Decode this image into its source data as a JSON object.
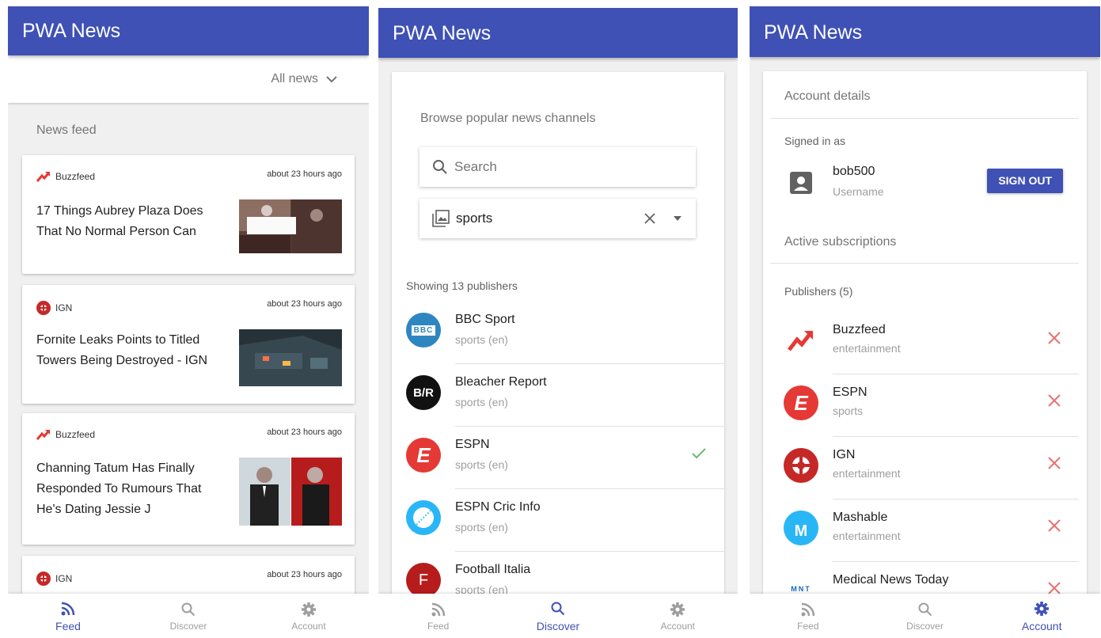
{
  "app_title": "PWA News",
  "colors": {
    "primary": "#3f51b5",
    "remove": "#e57373",
    "check": "#66bb6a"
  },
  "nav": {
    "feed": "Feed",
    "discover": "Discover",
    "account": "Account"
  },
  "feed": {
    "filter": "All news",
    "section": "News feed",
    "items": [
      {
        "source": "Buzzfeed",
        "time": "about 23 hours ago",
        "title": "17 Things Aubrey Plaza Does That No Normal Person Can"
      },
      {
        "source": "IGN",
        "time": "about 23 hours ago",
        "title": "Fornite Leaks Points to Titled Towers Being Destroyed - IGN"
      },
      {
        "source": "Buzzfeed",
        "time": "about 23 hours ago",
        "title": "Channing Tatum Has Finally Responded To Rumours That He's Dating Jessie J"
      },
      {
        "source": "IGN",
        "time": "about 23 hours ago",
        "title": ""
      }
    ]
  },
  "discover": {
    "heading": "Browse popular news channels",
    "search_placeholder": "Search",
    "category": "sports",
    "showing": "Showing 13 publishers",
    "publishers": [
      {
        "name": "BBC Sport",
        "cat": "sports (en)",
        "logo": "BBC"
      },
      {
        "name": "Bleacher Report",
        "cat": "sports (en)",
        "logo": "B/R"
      },
      {
        "name": "ESPN",
        "cat": "sports (en)",
        "logo": "E"
      },
      {
        "name": "ESPN Cric Info",
        "cat": "sports (en)",
        "logo": ""
      },
      {
        "name": "Football Italia",
        "cat": "sports (en)",
        "logo": "F"
      }
    ]
  },
  "account": {
    "heading": "Account details",
    "signed_in_as": "Signed in as",
    "username": "bob500",
    "username_label": "Username",
    "sign_out": "SIGN OUT",
    "active_subs": "Active subscriptions",
    "publishers_count": "Publishers (5)",
    "subscriptions": [
      {
        "name": "Buzzfeed",
        "cat": "entertainment"
      },
      {
        "name": "ESPN",
        "cat": "sports",
        "logo": "E"
      },
      {
        "name": "IGN",
        "cat": "entertainment"
      },
      {
        "name": "Mashable",
        "cat": "entertainment",
        "logo": "M"
      },
      {
        "name": "Medical News Today",
        "cat": "",
        "logo": "MNT"
      }
    ]
  }
}
